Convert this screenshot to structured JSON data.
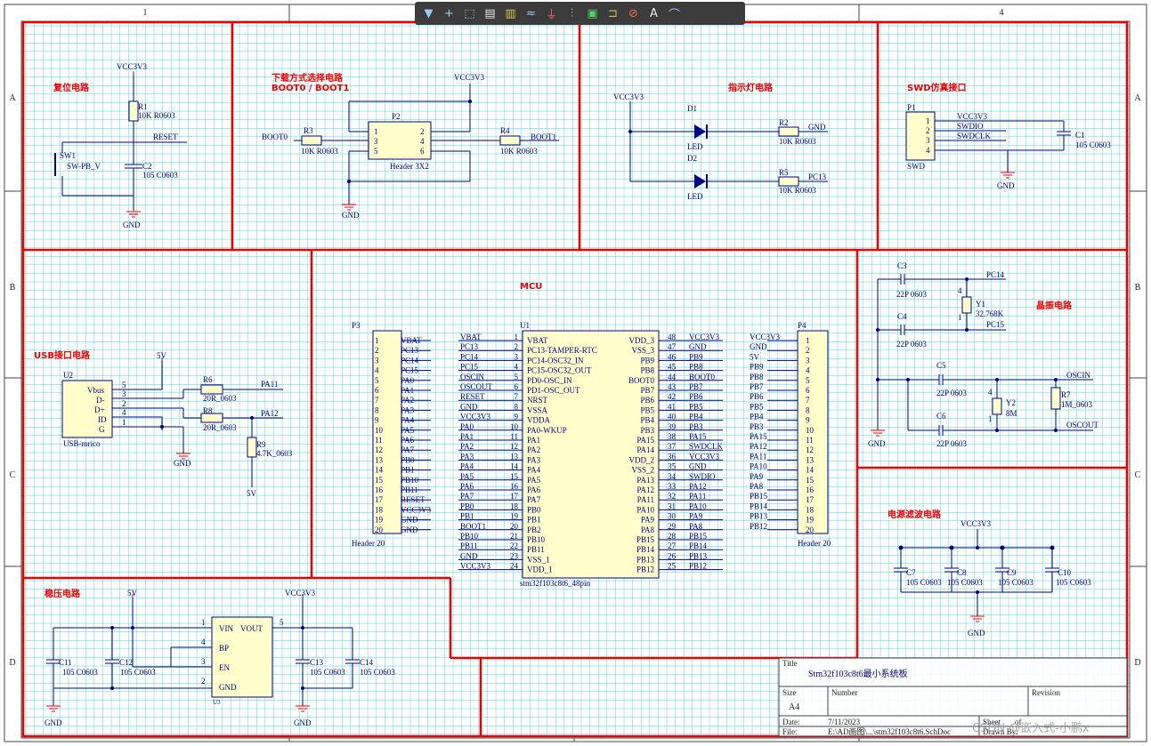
{
  "toolbar": {
    "tools": [
      {
        "name": "filter-icon",
        "glyph": "▼",
        "tone": "b"
      },
      {
        "name": "add-cross-icon",
        "glyph": "+",
        "tone": "b"
      },
      {
        "name": "select-rect-icon",
        "glyph": "⬚",
        "tone": "b"
      },
      {
        "name": "align-icon",
        "glyph": "▤",
        "tone": "w"
      },
      {
        "name": "component-icon",
        "glyph": "▥",
        "tone": "y"
      },
      {
        "name": "wire-icon",
        "glyph": "≈",
        "tone": "b"
      },
      {
        "name": "ground-icon",
        "glyph": "⏚",
        "tone": "r"
      },
      {
        "name": "bus-icon",
        "glyph": "⫶",
        "tone": "b"
      },
      {
        "name": "chip-icon",
        "glyph": "▣",
        "tone": "g"
      },
      {
        "name": "port-icon",
        "glyph": "⊐",
        "tone": "y"
      },
      {
        "name": "no-erc-icon",
        "glyph": "⊘",
        "tone": "r"
      },
      {
        "name": "text-icon",
        "glyph": "A",
        "tone": "w"
      },
      {
        "name": "arc-icon",
        "glyph": "⌒",
        "tone": "b"
      }
    ]
  },
  "border": {
    "columns": [
      "1",
      "4"
    ],
    "rows": [
      "A",
      "B",
      "C",
      "D"
    ]
  },
  "sections": {
    "reset": "复位电路",
    "boot": "下载方式选择电路",
    "boot_sub": "BOOT0 / BOOT1",
    "led": "指示灯电路",
    "swd": "SWD仿真接口",
    "usb": "USB接口电路",
    "mcu": "MCU",
    "crystal": "晶振电路",
    "filter": "电源滤波电路",
    "regulator": "稳压电路"
  },
  "reset": {
    "vcc": "VCC3V3",
    "r1": "R1",
    "r1v": "10K R0603",
    "reset": "RESET",
    "sw": "SW1",
    "swv": "SW-PB_V",
    "c2": "C2",
    "c2v": "105 C0603",
    "gnd": "GND"
  },
  "boot": {
    "vcc": "VCC3V3",
    "p2": "P2",
    "pins": [
      "1",
      "2",
      "3",
      "4",
      "5",
      "6"
    ],
    "header": "Header 3X2",
    "boot0": "BOOT0",
    "r3": "R3",
    "r3v": "10K R0603",
    "boot1": "BOOT1",
    "r4": "R4",
    "r4v": "10K R0603",
    "gnd": "GND"
  },
  "led": {
    "vcc": "VCC3V3",
    "d1": "D1",
    "d2": "D2",
    "ledv": "LED",
    "r2": "R2",
    "r5": "R5",
    "rv": "10K R0603",
    "gnd": "GND",
    "pc13": "PC13"
  },
  "swd": {
    "p1": "P1",
    "pins": [
      "1",
      "2",
      "3",
      "4"
    ],
    "nets": [
      "VCC3V3",
      "SWDIO",
      "SWDCLK"
    ],
    "name": "SWD",
    "c1": "C1",
    "c1v": "105 C0603",
    "gnd": "GND"
  },
  "usb": {
    "u2": "U2",
    "pins": [
      "Vbus",
      "D-",
      "D+",
      "ID",
      "G"
    ],
    "nums": [
      "5",
      "3",
      "2",
      "4",
      "1"
    ],
    "name": "USB-mrico",
    "v5": "5V",
    "r6": "R6",
    "r8": "R8",
    "rv": "20R_0603",
    "pa11": "PA11",
    "pa12": "PA12",
    "r9": "R9",
    "r9v": "4.7K_0603",
    "gnd": "GND",
    "v5b": "5V"
  },
  "p3": {
    "ref": "P3",
    "name": "Header 20",
    "nets": [
      "VBAT",
      "PC13",
      "PC14",
      "PC15",
      "PA0",
      "PA1",
      "PA2",
      "PA3",
      "PA4",
      "PA5",
      "PA6",
      "PA7",
      "PB0",
      "PB1",
      "PB10",
      "PB11",
      "RESET",
      "VCC3V3",
      "GND",
      "GND"
    ]
  },
  "p4": {
    "ref": "P4",
    "name": "Header 20",
    "nets": [
      "VCC3V3",
      "GND",
      "5V",
      "PB9",
      "PB8",
      "PB7",
      "PB6",
      "PB5",
      "PB4",
      "PB3",
      "PA15",
      "PA12",
      "PA11",
      "PA10",
      "PA9",
      "PA8",
      "PB15",
      "PB14",
      "PB13",
      "PB12"
    ]
  },
  "u1": {
    "ref": "U1",
    "name": "stm32f103c8t6_48pin",
    "left_nets": [
      "VBAT",
      "PC13",
      "PC14",
      "PC15",
      "OSCIN",
      "OSCOUT",
      "RESET",
      "GND",
      "VCC3V3",
      "PA0",
      "PA1",
      "PA2",
      "PA3",
      "PA4",
      "PA5",
      "PA6",
      "PA7",
      "PB0",
      "PB1",
      "BOOT1",
      "PB10",
      "PB11",
      "GND",
      "VCC3V3"
    ],
    "left_pins": [
      "VBAT",
      "PC13-TAMPER-RTC",
      "PC14-OSC32_IN",
      "PC15-OSC32_OUT",
      "PD0-OSC_IN",
      "PD1-OSC_OUT",
      "NRST",
      "VSSA",
      "VDDA",
      "PA0-WKUP",
      "PA1",
      "PA2",
      "PA3",
      "PA4",
      "PA5",
      "PA6",
      "PA7",
      "PB0",
      "PB1",
      "PB2",
      "PB10",
      "PB11",
      "VSS_1",
      "VDD_1"
    ],
    "right_nums": [
      "48",
      "47",
      "46",
      "45",
      "44",
      "43",
      "42",
      "41",
      "40",
      "39",
      "38",
      "37",
      "36",
      "35",
      "34",
      "33",
      "32",
      "31",
      "30",
      "29",
      "28",
      "27",
      "26",
      "25"
    ],
    "right_pins": [
      "VDD_3",
      "VSS_3",
      "PB9",
      "PB8",
      "BOOT0",
      "PB7",
      "PB6",
      "PB5",
      "PB4",
      "PB3",
      "PA15",
      "PA14",
      "VDD_2",
      "VSS_2",
      "PA13",
      "PA12",
      "PA11",
      "PA10",
      "PA9",
      "PA8",
      "PB15",
      "PB14",
      "PB13",
      "PB12"
    ],
    "right_nets": [
      "VCC3V3",
      "GND",
      "PB9",
      "PB8",
      "BOOT0",
      "PB7",
      "PB6",
      "PB5",
      "PB4",
      "PB3",
      "PA15",
      "SWDCLK",
      "VCC3V3",
      "GND",
      "SWDIO",
      "PA12",
      "PA11",
      "PA10",
      "PA9",
      "PA8",
      "PB15",
      "PB14",
      "PB13",
      "PB12"
    ]
  },
  "crystal": {
    "c3": "C3",
    "c4": "C4",
    "c5": "C5",
    "c6": "C6",
    "cv": "22P 0603",
    "y1": "Y1",
    "y1v": "32.768K",
    "y2": "Y2",
    "y2v": "8M",
    "pc14": "PC14",
    "pc15": "PC15",
    "oscin": "OSCIN",
    "oscout": "OSCOUT",
    "r7": "R7",
    "r7v": "1M_0603",
    "gnd": "GND",
    "pin4": "4",
    "pin1": "1"
  },
  "filter": {
    "vcc": "VCC3V3",
    "caps": [
      "C7",
      "C8",
      "C9",
      "C10"
    ],
    "cv": "105 C0603",
    "gnd": "GND"
  },
  "regulator": {
    "v5": "5V",
    "vcc": "VCC3V3",
    "c11": "C11",
    "c12": "C12",
    "c13": "C13",
    "c14": "C14",
    "cv": "105 C0603",
    "u3": "U3",
    "vin": "VIN",
    "vout": "VOUT",
    "bp": "BP",
    "en": "EN",
    "gnd_pin": "GND",
    "p1": "1",
    "p4": "4",
    "p3": "3",
    "p2": "2",
    "p5": "5",
    "gnd": "GND"
  },
  "titleblock": {
    "title_lbl": "Title",
    "title": "Stm32f103c8t6最小系统板",
    "size_lbl": "Size",
    "size": "A4",
    "number_lbl": "Number",
    "revision_lbl": "Revision",
    "date_lbl": "Date:",
    "date": "7/11/2023",
    "sheet_lbl": "Sheet",
    "of": "of",
    "file_lbl": "File:",
    "file": "E:\\AD画图\\...\\stm32f103c8t6.SchDoc",
    "drawn_lbl": "Drawn By:"
  },
  "watermark": "CSDN @嵌入式-小鹏x"
}
